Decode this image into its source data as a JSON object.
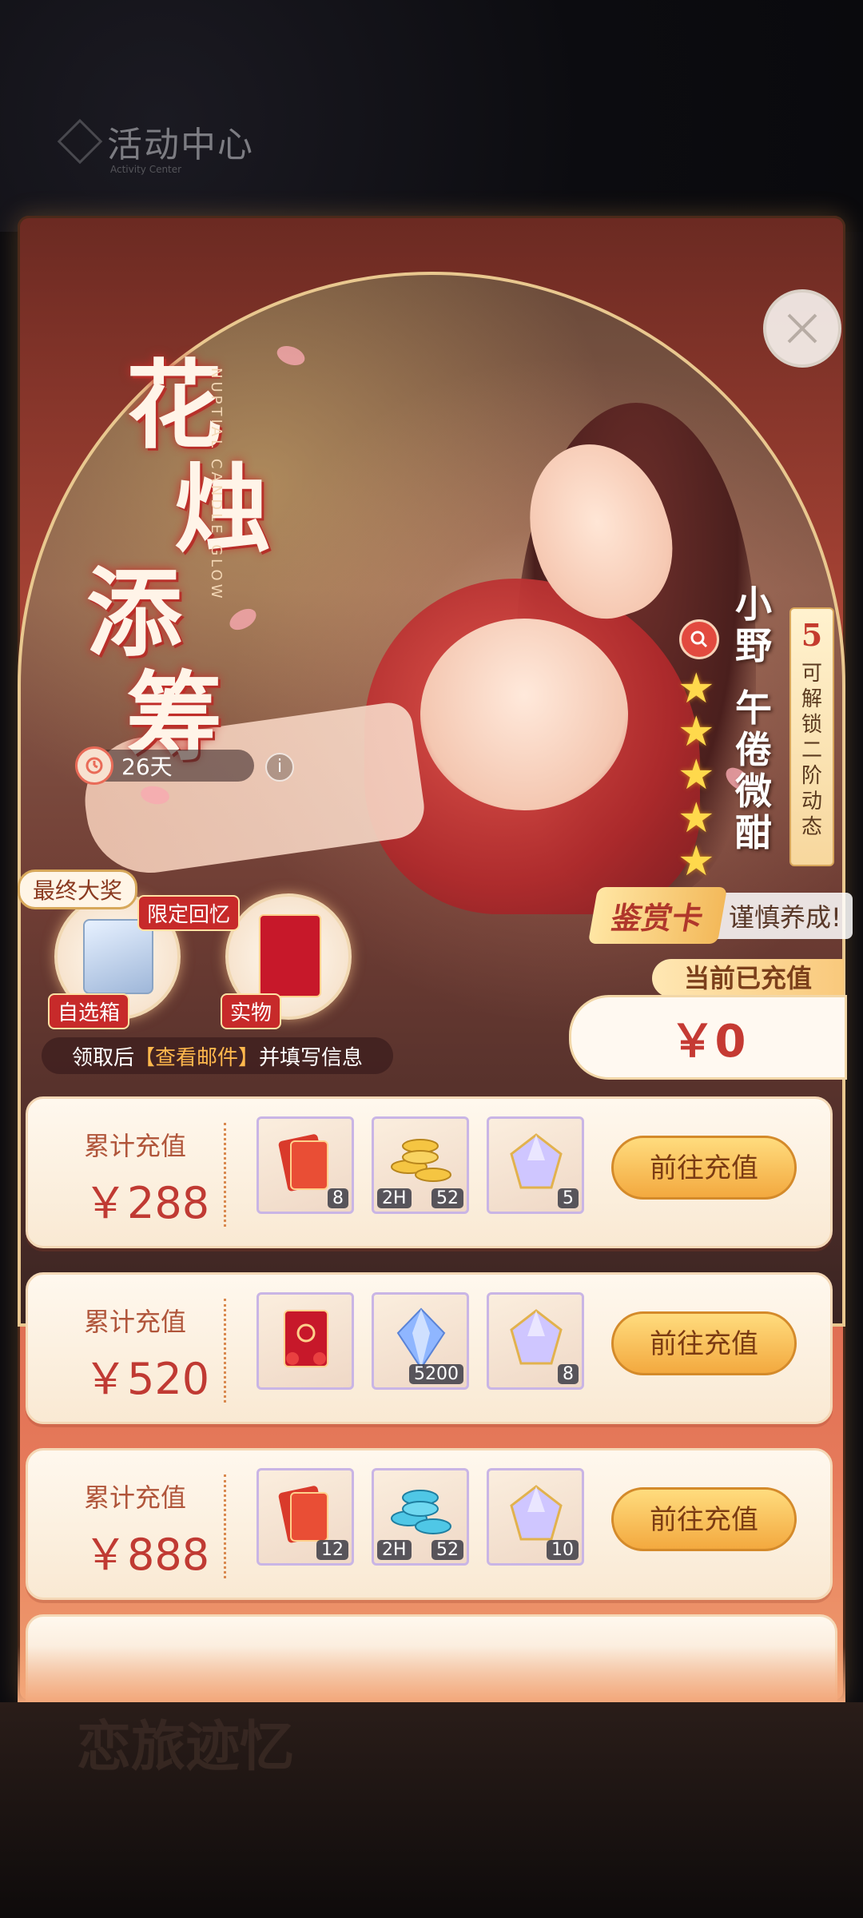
{
  "header": {
    "title": "活动中心",
    "subtitle": "Activity Center"
  },
  "banner": {
    "title_chars": [
      "花",
      "烛",
      "添",
      "筹"
    ],
    "title_en": "NUPTIAL CANDLE GLOW",
    "timer": "26天",
    "character": {
      "name_line1": "小野",
      "name_line2": "午倦微酣",
      "stars": 5
    },
    "unlock": {
      "number": "5",
      "text": "可解锁二阶动态"
    },
    "appreciate_card": "鉴赏卡",
    "appreciate_hint": "谨慎养成!",
    "current_recharge_label": "当前已充值",
    "current_recharge_value": "￥0",
    "final_prize_label": "最终大奖",
    "prize1_tag": "自选箱",
    "prize_limited_tag": "限定回忆",
    "prize2_tag": "实物",
    "mail_note_prefix": "领取后",
    "mail_note_link": "【查看邮件】",
    "mail_note_suffix": "并填写信息"
  },
  "rows": [
    {
      "label": "累计充值",
      "amount": "￥288",
      "button": "前往充值",
      "items": [
        {
          "icon": "red-envelope-icon",
          "count": "8",
          "time": ""
        },
        {
          "icon": "gold-coins-icon",
          "count": "52",
          "time": "2H"
        },
        {
          "icon": "crystal-icon",
          "count": "5",
          "time": ""
        }
      ]
    },
    {
      "label": "累计充值",
      "amount": "￥520",
      "button": "前往充值",
      "items": [
        {
          "icon": "marriage-certificate-icon",
          "count": "",
          "time": ""
        },
        {
          "icon": "blue-diamond-icon",
          "count": "5200",
          "time": ""
        },
        {
          "icon": "crystal-icon",
          "count": "8",
          "time": ""
        }
      ]
    },
    {
      "label": "累计充值",
      "amount": "￥888",
      "button": "前往充值",
      "items": [
        {
          "icon": "red-envelope-icon",
          "count": "12",
          "time": ""
        },
        {
          "icon": "exp-coins-icon",
          "count": "52",
          "time": "2H"
        },
        {
          "icon": "crystal-icon",
          "count": "10",
          "time": ""
        }
      ]
    }
  ],
  "bottom": {
    "text": "恋旅迹忆"
  },
  "colors": {
    "accent": "#c03a33",
    "button": "#f3a93f",
    "panel": "#d75d48"
  }
}
